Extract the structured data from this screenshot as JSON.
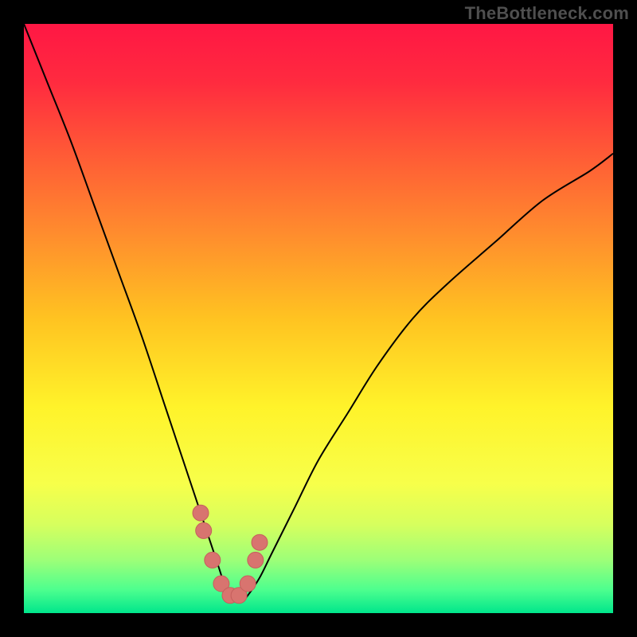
{
  "watermark": "TheBottleneck.com",
  "colors": {
    "frame_bg": "#000000",
    "watermark_text": "#4f4f4f",
    "curve_stroke": "#000000",
    "marker_fill": "#d8746f",
    "marker_stroke": "#c55f5c",
    "gradient_stops": [
      {
        "offset": 0.0,
        "color": "#ff1744"
      },
      {
        "offset": 0.1,
        "color": "#ff2b3f"
      },
      {
        "offset": 0.22,
        "color": "#ff5a36"
      },
      {
        "offset": 0.35,
        "color": "#ff8a2e"
      },
      {
        "offset": 0.5,
        "color": "#ffc321"
      },
      {
        "offset": 0.65,
        "color": "#fff32a"
      },
      {
        "offset": 0.78,
        "color": "#f7ff4a"
      },
      {
        "offset": 0.85,
        "color": "#d6ff5e"
      },
      {
        "offset": 0.91,
        "color": "#9dff78"
      },
      {
        "offset": 0.96,
        "color": "#4eff8e"
      },
      {
        "offset": 1.0,
        "color": "#00e68c"
      }
    ]
  },
  "chart_data": {
    "type": "line",
    "title": "",
    "xlabel": "",
    "ylabel": "",
    "xlim": [
      0,
      100
    ],
    "ylim": [
      0,
      100
    ],
    "grid": false,
    "legend": "none",
    "series": [
      {
        "name": "curve",
        "x": [
          0,
          4,
          8,
          12,
          16,
          20,
          24,
          26,
          28,
          30,
          32,
          33,
          34,
          35,
          36,
          37,
          38,
          40,
          42,
          46,
          50,
          55,
          60,
          66,
          72,
          80,
          88,
          96,
          100
        ],
        "y": [
          100,
          90,
          80,
          69,
          58,
          47,
          35,
          29,
          23,
          17,
          11,
          8,
          5,
          3,
          2,
          2,
          3,
          6,
          10,
          18,
          26,
          34,
          42,
          50,
          56,
          63,
          70,
          75,
          78
        ]
      }
    ],
    "markers": {
      "name": "highlight-points",
      "x": [
        30.0,
        30.5,
        32.0,
        33.5,
        35.0,
        36.5,
        38.0,
        39.3,
        40.0
      ],
      "y": [
        17.0,
        14.0,
        9.0,
        5.0,
        3.0,
        3.0,
        5.0,
        9.0,
        12.0
      ]
    },
    "notes": "Values are approximate readings from an unlabeled V-shaped bottleneck curve over a rainbow gradient; minimum near x≈35, y≈2. Right branch rises less steeply than the left."
  }
}
